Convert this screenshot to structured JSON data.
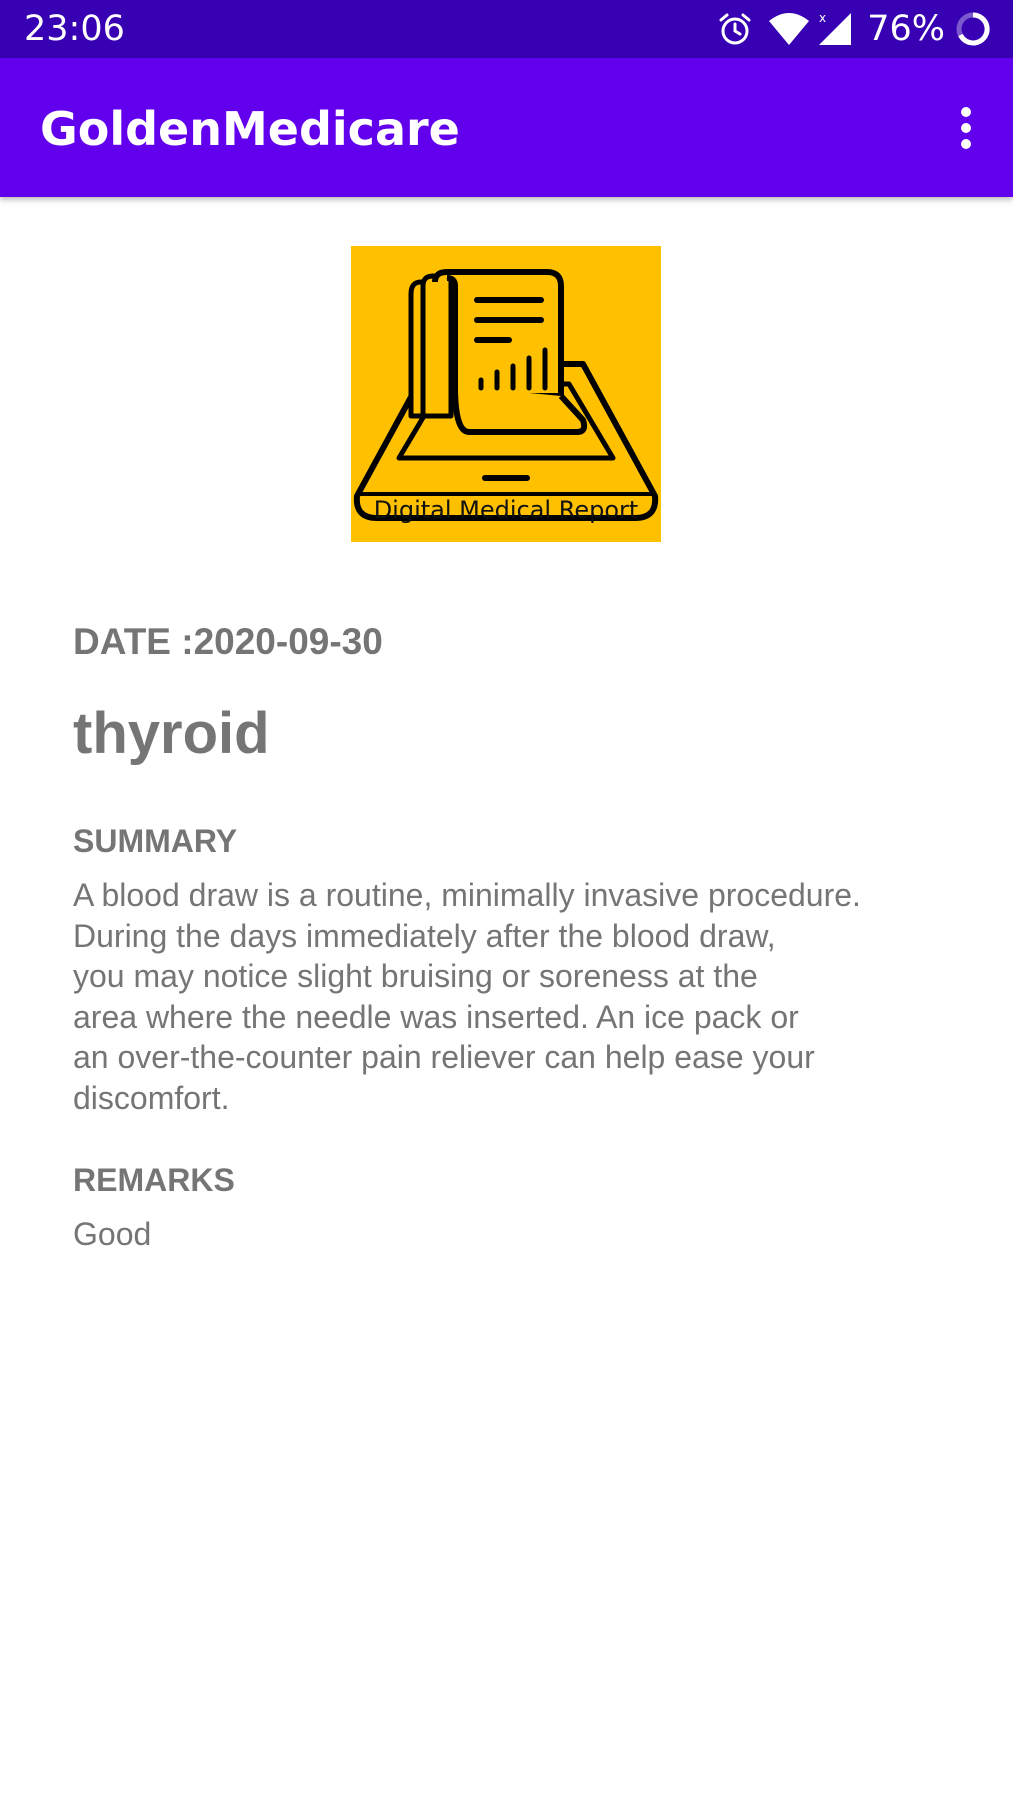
{
  "status_bar": {
    "time": "23:06",
    "battery": "76%",
    "icons": [
      "alarm-icon",
      "wifi-icon",
      "cell-signal-icon",
      "battery-icon"
    ]
  },
  "app_bar": {
    "title": "GoldenMedicare",
    "menu_icon": "more-vert-icon"
  },
  "logo": {
    "caption": "Digital Medical Report",
    "background": "#ffc000"
  },
  "report": {
    "date": "DATE :2020-09-30",
    "title": "thyroid",
    "summary_label": "SUMMARY",
    "summary_lines": [
      "A blood draw is a routine, minimally invasive procedure.",
      "During the days immediately after the blood draw,",
      "you may notice slight bruising or soreness at the",
      "area where the needle was inserted. An ice pack or",
      "an over-the-counter pain reliever can help ease your",
      "discomfort."
    ],
    "remarks_label": "REMARKS",
    "remarks": "Good"
  },
  "colors": {
    "status_bar": "#3700b3",
    "app_bar": "#6200ee",
    "text": "#757575"
  }
}
